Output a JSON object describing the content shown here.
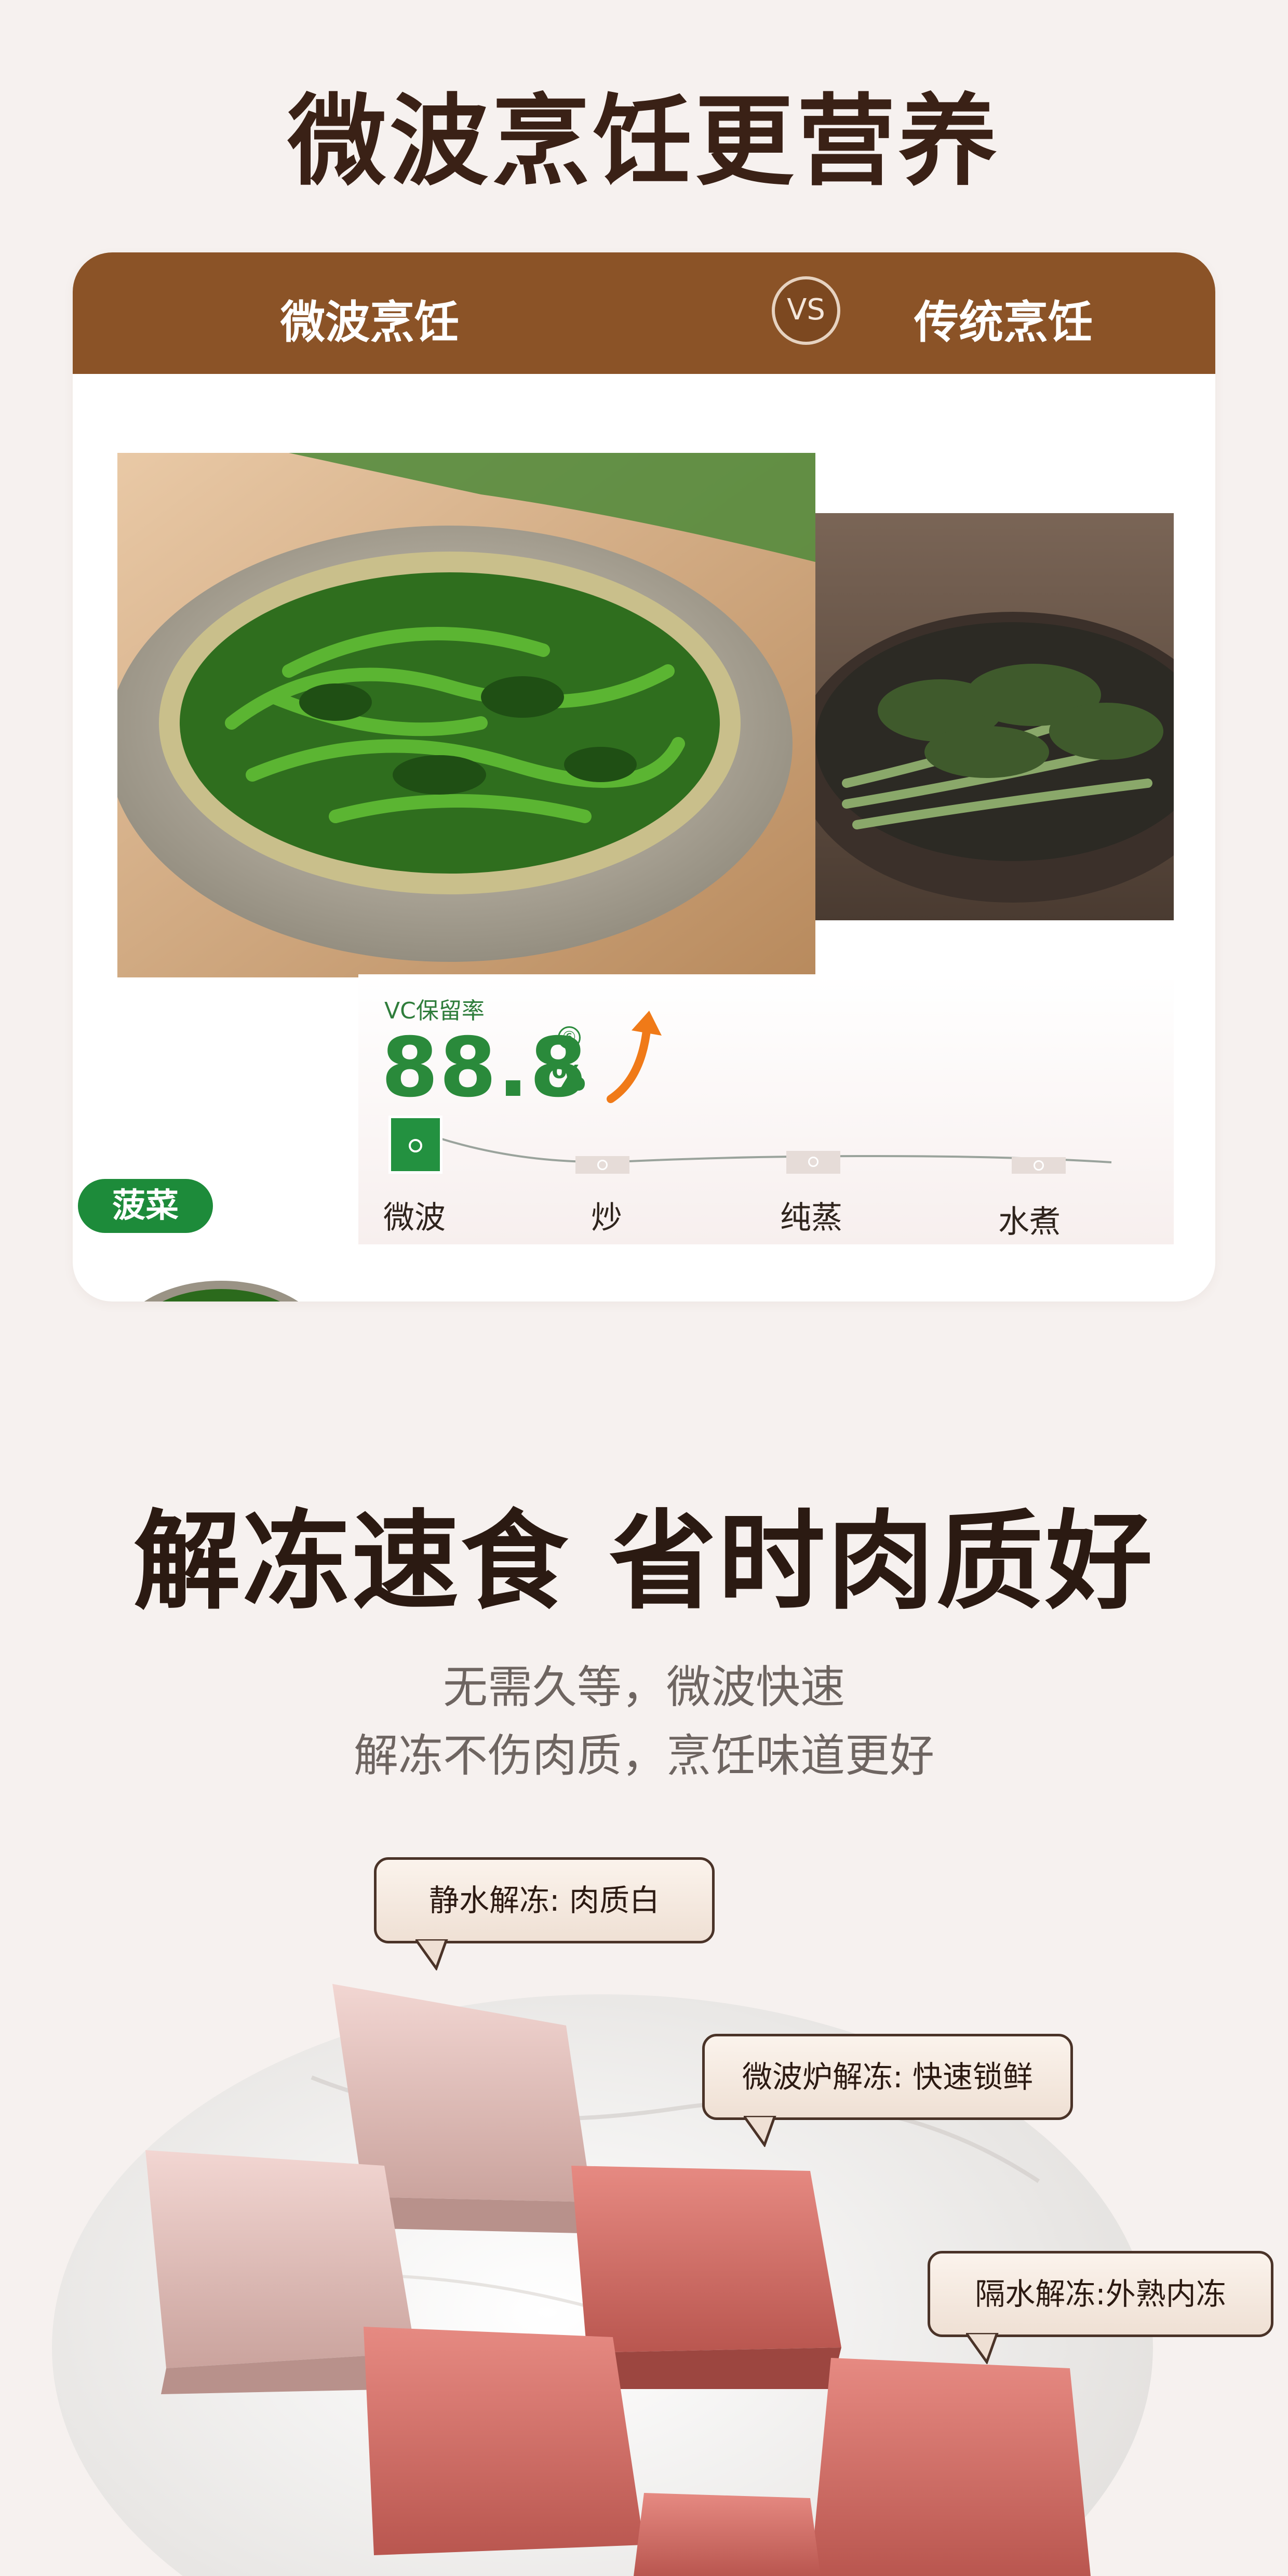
{
  "section1": {
    "title": "微波烹饪更营养",
    "compare": {
      "left_label": "微波烹饪",
      "vs_label": "VS",
      "right_label": "传统烹饪"
    },
    "metric": {
      "label": "VC保留率",
      "value": "88.8",
      "unit": "%",
      "note_marker": "⑥"
    },
    "food_tag": "菠菜",
    "methods": [
      "微波",
      "炒",
      "纯蒸",
      "水煮"
    ]
  },
  "section2": {
    "title": "解冻速食 省时肉质好",
    "subtitle_lines": [
      "无需久等，微波快速",
      "解冻不伤肉质，烹饪味道更好"
    ],
    "callouts": [
      "静水解冻: 肉质白",
      "微波炉解冻: 快速锁鲜",
      "隔水解冻:外熟内冻"
    ]
  },
  "colors": {
    "background": "#f6f1ef",
    "header_brown": "#8b5327",
    "accent_green": "#2a8a3b",
    "title_dark": "#3a2116"
  }
}
